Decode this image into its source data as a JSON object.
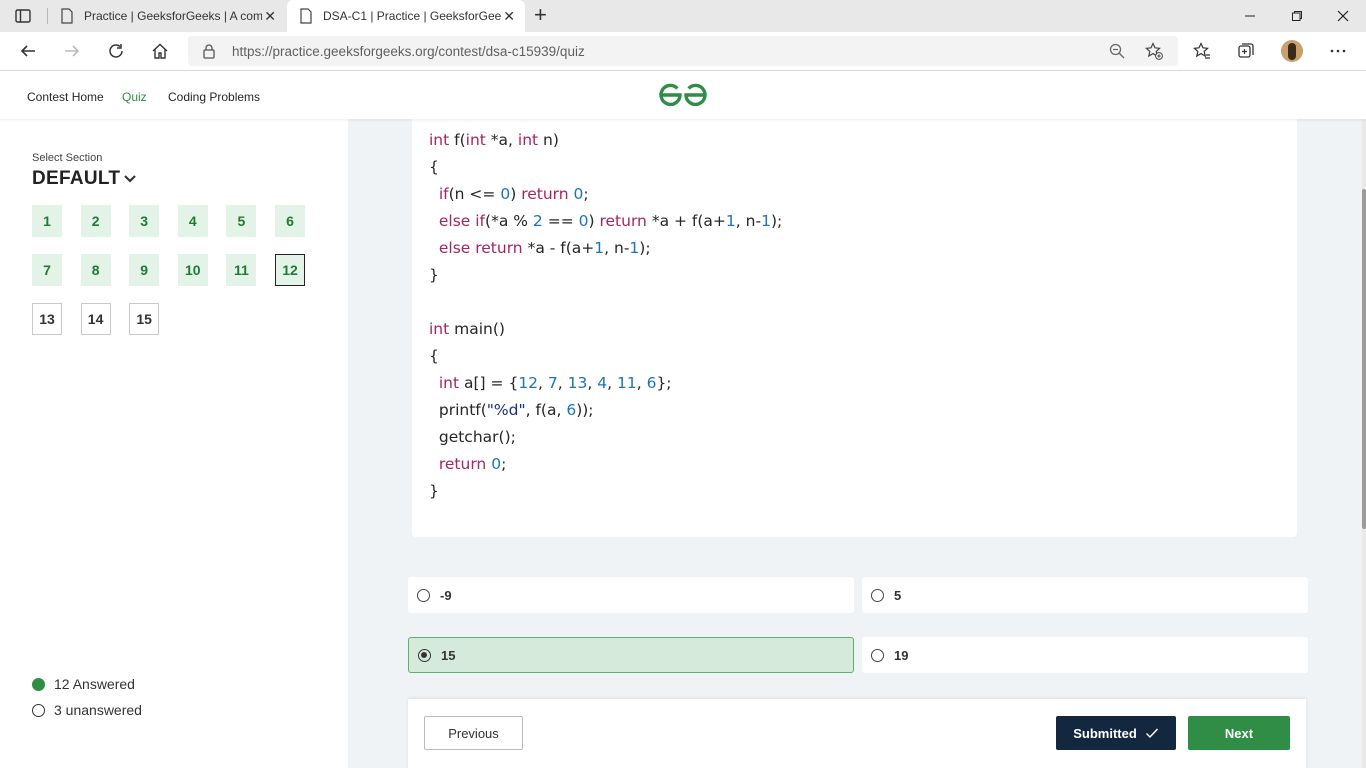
{
  "browser": {
    "tabs": [
      {
        "title": "Practice | GeeksforGeeks | A com",
        "active": false
      },
      {
        "title": "DSA-C1 | Practice | GeeksforGeel",
        "active": true
      }
    ],
    "url": "https://practice.geeksforgeeks.org/contest/dsa-c15939/quiz"
  },
  "header": {
    "nav": [
      "Contest Home",
      "Quiz",
      "Coding Problems"
    ],
    "active_nav": "Quiz",
    "logo": "GeeksforGeeks logo"
  },
  "sidebar": {
    "section_label": "Select Section",
    "section_name": "DEFAULT",
    "questions": [
      {
        "n": "1",
        "state": "answered"
      },
      {
        "n": "2",
        "state": "answered"
      },
      {
        "n": "3",
        "state": "answered"
      },
      {
        "n": "4",
        "state": "answered"
      },
      {
        "n": "5",
        "state": "answered"
      },
      {
        "n": "6",
        "state": "answered"
      },
      {
        "n": "7",
        "state": "answered"
      },
      {
        "n": "8",
        "state": "answered"
      },
      {
        "n": "9",
        "state": "answered"
      },
      {
        "n": "10",
        "state": "answered"
      },
      {
        "n": "11",
        "state": "answered"
      },
      {
        "n": "12",
        "state": "current"
      },
      {
        "n": "13",
        "state": "unanswered"
      },
      {
        "n": "14",
        "state": "unanswered"
      },
      {
        "n": "15",
        "state": "unanswered"
      }
    ],
    "answered_label": "12 Answered",
    "unanswered_label": "3 unanswered"
  },
  "question": {
    "code_lines": [
      [
        {
          "t": "int",
          "c": "kw"
        },
        {
          "t": " f("
        },
        {
          "t": "int",
          "c": "kw"
        },
        {
          "t": " *a, "
        },
        {
          "t": "int",
          "c": "kw"
        },
        {
          "t": " n)"
        }
      ],
      [
        {
          "t": "{"
        }
      ],
      [
        {
          "t": "  "
        },
        {
          "t": "if",
          "c": "kw"
        },
        {
          "t": "(n <= "
        },
        {
          "t": "0",
          "c": "num"
        },
        {
          "t": ") "
        },
        {
          "t": "return",
          "c": "kw"
        },
        {
          "t": " "
        },
        {
          "t": "0",
          "c": "num"
        },
        {
          "t": ";"
        }
      ],
      [
        {
          "t": "  "
        },
        {
          "t": "else if",
          "c": "kw"
        },
        {
          "t": "(*a % "
        },
        {
          "t": "2",
          "c": "num"
        },
        {
          "t": " == "
        },
        {
          "t": "0",
          "c": "num"
        },
        {
          "t": ") "
        },
        {
          "t": "return",
          "c": "kw"
        },
        {
          "t": " *a + f(a+"
        },
        {
          "t": "1",
          "c": "num"
        },
        {
          "t": ", n-"
        },
        {
          "t": "1",
          "c": "num"
        },
        {
          "t": ");"
        }
      ],
      [
        {
          "t": "  "
        },
        {
          "t": "else return",
          "c": "kw"
        },
        {
          "t": " *a - f(a+"
        },
        {
          "t": "1",
          "c": "num"
        },
        {
          "t": ", n-"
        },
        {
          "t": "1",
          "c": "num"
        },
        {
          "t": ");"
        }
      ],
      [
        {
          "t": "}"
        }
      ],
      [
        {
          "t": ""
        }
      ],
      [
        {
          "t": "int",
          "c": "kw"
        },
        {
          "t": " main()"
        }
      ],
      [
        {
          "t": "{"
        }
      ],
      [
        {
          "t": "  "
        },
        {
          "t": "int",
          "c": "kw"
        },
        {
          "t": " a[] = {"
        },
        {
          "t": "12",
          "c": "num"
        },
        {
          "t": ", "
        },
        {
          "t": "7",
          "c": "num"
        },
        {
          "t": ", "
        },
        {
          "t": "13",
          "c": "num"
        },
        {
          "t": ", "
        },
        {
          "t": "4",
          "c": "num"
        },
        {
          "t": ", "
        },
        {
          "t": "11",
          "c": "num"
        },
        {
          "t": ", "
        },
        {
          "t": "6",
          "c": "num"
        },
        {
          "t": "};"
        }
      ],
      [
        {
          "t": "  printf("
        },
        {
          "t": "\"%d\"",
          "c": "str"
        },
        {
          "t": ", f(a, "
        },
        {
          "t": "6",
          "c": "num"
        },
        {
          "t": "));"
        }
      ],
      [
        {
          "t": "  getchar();"
        }
      ],
      [
        {
          "t": "  "
        },
        {
          "t": "return",
          "c": "kw"
        },
        {
          "t": " "
        },
        {
          "t": "0",
          "c": "num"
        },
        {
          "t": ";"
        }
      ],
      [
        {
          "t": "}"
        }
      ]
    ],
    "options": [
      {
        "label": "-9",
        "selected": false
      },
      {
        "label": "5",
        "selected": false
      },
      {
        "label": "15",
        "selected": true
      },
      {
        "label": "19",
        "selected": false
      }
    ]
  },
  "footer": {
    "previous_label": "Previous",
    "submitted_label": "Submitted",
    "next_label": "Next"
  },
  "colors": {
    "brand_green": "#2f8d46",
    "submitted_navy": "#13283e",
    "answered_bg": "#e4f3e7"
  }
}
